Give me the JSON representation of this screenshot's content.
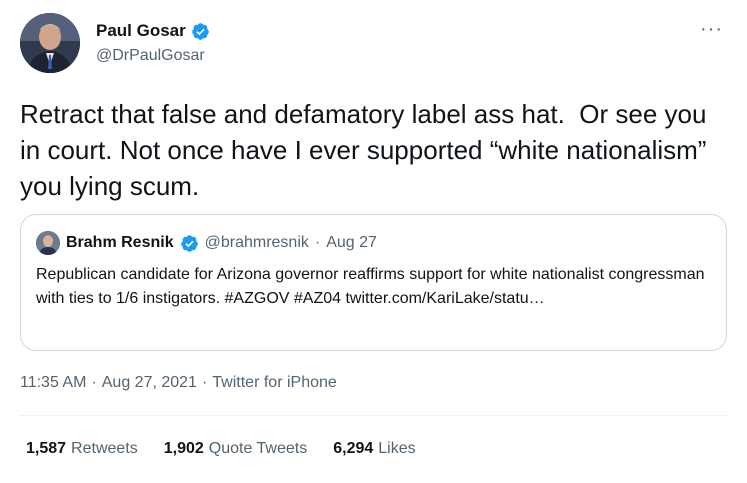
{
  "author": {
    "display_name": "Paul Gosar",
    "handle": "@DrPaulGosar",
    "verified": true
  },
  "tweet": {
    "text": "Retract that false and defamatory label ass hat.  Or see you in court. Not once have I ever supported “white nationalism” you lying scum."
  },
  "quoted_tweet": {
    "display_name": "Brahm Resnik",
    "handle": "@brahmresnik",
    "separator": "·",
    "date": "Aug 27",
    "text": "Republican candidate for Arizona governor reaffirms support for white nationalist congressman with ties to 1/6 instigators. #AZGOV #AZ04 twitter.com/KariLake/statu…"
  },
  "meta": {
    "time": "11:35 AM",
    "sep1": "·",
    "date": "Aug 27, 2021",
    "sep2": "·",
    "source": "Twitter for iPhone"
  },
  "stats": [
    {
      "count": "1,587",
      "label": "Retweets"
    },
    {
      "count": "1,902",
      "label": "Quote Tweets"
    },
    {
      "count": "6,294",
      "label": "Likes"
    }
  ],
  "icons": {
    "more": "more-icon",
    "verified": "verified-badge-icon"
  },
  "colors": {
    "verified_blue": "#1d9bf0",
    "secondary_text": "#536471",
    "border": "#cfd9de"
  }
}
